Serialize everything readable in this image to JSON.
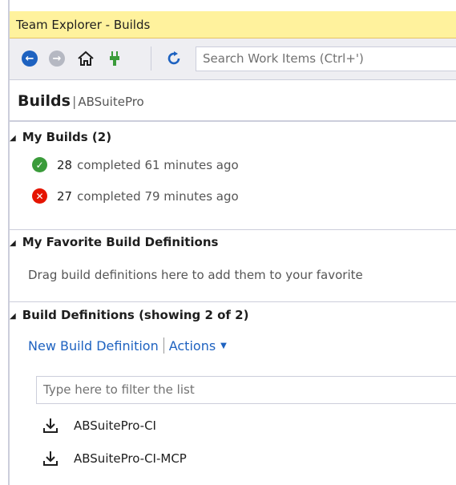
{
  "window": {
    "title": "Team Explorer - Builds"
  },
  "toolbar": {
    "search_placeholder": "Search Work Items (Ctrl+')",
    "icons": [
      "back-arrow-icon",
      "forward-arrow-icon",
      "home-icon",
      "plug-icon",
      "refresh-icon"
    ]
  },
  "header": {
    "title": "Builds",
    "separator": "|",
    "project": "ABSuitePro"
  },
  "my_builds": {
    "heading": "My Builds (2)",
    "items": [
      {
        "number": "28",
        "text": "completed 61 minutes ago",
        "status": "success"
      },
      {
        "number": "27",
        "text": "completed 79 minutes ago",
        "status": "failed"
      }
    ]
  },
  "favorites": {
    "heading": "My Favorite Build Definitions",
    "hint": "Drag build definitions here to add them to your favorite"
  },
  "definitions": {
    "heading": "Build Definitions (showing 2 of 2)",
    "new_link": "New Build Definition",
    "actions_link": "Actions",
    "filter_placeholder": "Type here to filter the list",
    "items": [
      {
        "name": "ABSuitePro-CI"
      },
      {
        "name": "ABSuitePro-CI-MCP"
      }
    ]
  },
  "colors": {
    "title_bar": "#fff29d",
    "accent_blue": "#1e62c0",
    "success": "#3a9b3a",
    "failure": "#e51400"
  }
}
